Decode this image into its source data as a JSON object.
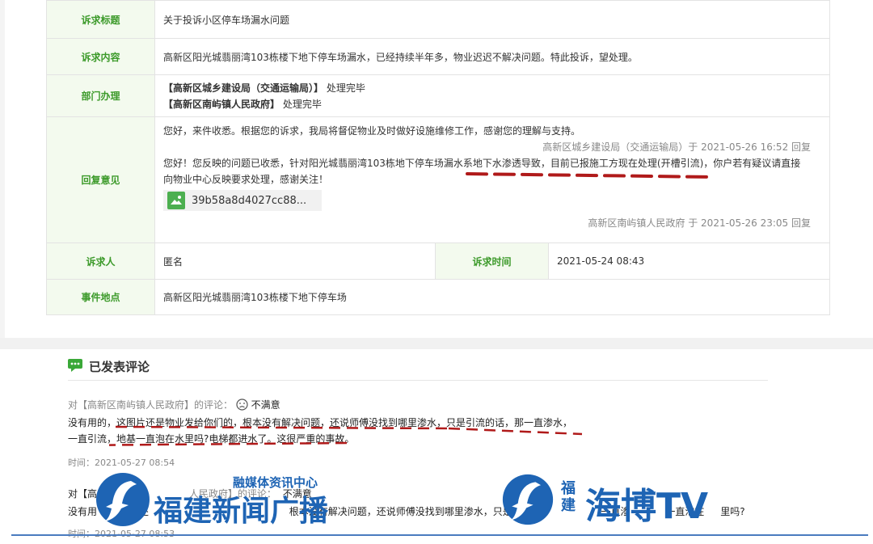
{
  "table": {
    "title_label": "诉求标题",
    "title_value": "关于投诉小区停车场漏水问题",
    "content_label": "诉求内容",
    "content_value": "高新区阳光城翡丽湾103栋楼下地下停车场漏水，已经持续半年多，物业迟迟不解决问题。特此投诉，望处理。",
    "dept_label": "部门办理",
    "dept_1_name": "【高新区城乡建设局（交通运输局）】",
    "dept_1_status": "处理完毕",
    "dept_2_name": "【高新区南屿镇人民政府】",
    "dept_2_status": "处理完毕",
    "reply_label": "回复意见",
    "reply_1": "您好，来件收悉。根据您的诉求，我局将督促物业及时做好设施维修工作，感谢您的理解与支持。",
    "reply_1_meta": "高新区城乡建设局（交通运输局）于 2021-05-26 16:52 回复",
    "reply_2_line1": "您好！您反映的问题已收悉，针对阳光城翡丽湾103栋地下停车场漏水系地下水渗透导致，目前已报施工方现在处理(开槽引流)，你户若有疑议请直接",
    "reply_2_line2": "向物业中心反映要求处理，感谢关注！",
    "attachment_name": "39b58a8d4027cc88...",
    "reply_2_meta": "高新区南屿镇人民政府 于 2021-05-26 23:05 回复",
    "person_label": "诉求人",
    "person_value": "匿名",
    "time_label": "诉求时间",
    "time_value": "2021-05-24 08:43",
    "location_label": "事件地点",
    "location_value": "高新区阳光城翡丽湾103栋楼下地下停车场"
  },
  "comments": {
    "title": "已发表评论",
    "items": [
      {
        "header_prefix": "对【高新区南屿镇人民政府】的评论：",
        "rating": "不满意",
        "line1": "没有用的，这图片还是物业发给你们的，根本没有解决问题，还说师傅没找到哪里渗水，只是引流的话，那一直渗水，",
        "line2": "一直引流，地基一直泡在水里吗?电梯都进水了。这很严重的事故。",
        "time": "时间：2021-05-27 08:54"
      },
      {
        "header_prefix": "对【高",
        "header_mid": "人民政府】的评论：",
        "rating": "不满意",
        "line1_a": "没有用",
        "line1_b": "片还",
        "line1_c": "根本没有解决问",
        "line1_d": "题，还说师傅没找到哪里渗水，只是引流的",
        "line1_e": "一直渗",
        "line1_f": "一直泡在",
        "line1_g": "里吗?",
        "time": "时间：2021-05-27 08:53"
      }
    ]
  },
  "watermarks": {
    "left_top": "融媒体资讯中心",
    "left_main": "福建新闻广播",
    "right_small_1": "福",
    "right_small_2": "建",
    "right_main": "海博TV"
  },
  "colors": {
    "label_green": "#3c9a2a",
    "label_bg": "#f3faee",
    "annotation_red": "#b01a1a",
    "watermark_blue": "#1e64b4"
  }
}
